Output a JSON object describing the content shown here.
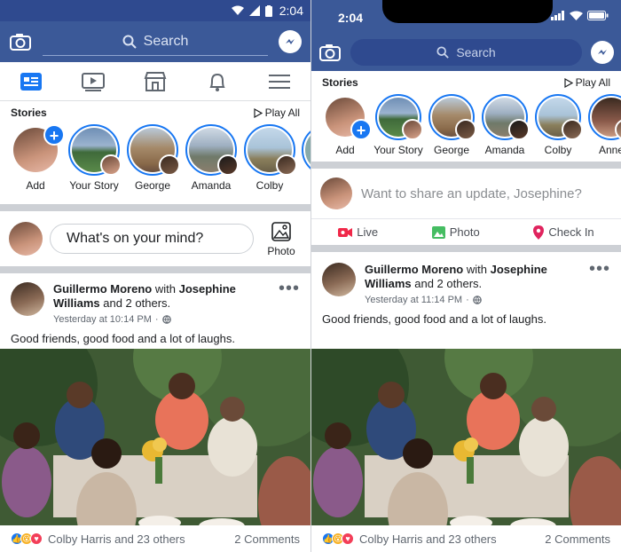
{
  "left": {
    "status": {
      "time": "2:04"
    },
    "search": {
      "placeholder": "Search"
    },
    "tabs": [
      "news-feed",
      "watch",
      "marketplace",
      "notifications",
      "menu"
    ],
    "stories": {
      "title": "Stories",
      "play_all": "Play All",
      "items": [
        "Add",
        "Your Story",
        "George",
        "Amanda",
        "Colby"
      ]
    },
    "composer": {
      "prompt": "What's on your mind?",
      "photo_label": "Photo"
    },
    "post": {
      "author": "Guillermo Moreno",
      "with_word": "with",
      "tagged": "Josephine Williams",
      "others": "and 2 others.",
      "time": "Yesterday at 10:14 PM",
      "text": "Good friends, good food and a lot of laughs."
    },
    "reactions": {
      "summary": "Colby Harris and 23 others",
      "comments": "2 Comments"
    }
  },
  "right": {
    "status": {
      "time": "2:04"
    },
    "search": {
      "placeholder": "Search"
    },
    "stories": {
      "title": "Stories",
      "play_all": "Play All",
      "items": [
        "Add",
        "Your Story",
        "George",
        "Amanda",
        "Colby",
        "Anne"
      ]
    },
    "composer": {
      "prompt": "Want to share an update, Josephine?"
    },
    "actions": {
      "live": "Live",
      "photo": "Photo",
      "checkin": "Check In"
    },
    "post": {
      "author": "Guillermo Moreno",
      "with_word": "with",
      "tagged": "Josephine Williams",
      "others": "and 2 others.",
      "time": "Yesterday at 11:14 PM",
      "text": "Good friends, good food and a lot of laughs."
    },
    "reactions": {
      "summary": "Colby Harris and 23 others",
      "comments": "2 Comments"
    }
  },
  "colors": {
    "brand": "#3b5998",
    "accent": "#1877f2",
    "love": "#f33e58",
    "live": "#f02849",
    "photo": "#45bd62",
    "checkin": "#f5533d"
  }
}
